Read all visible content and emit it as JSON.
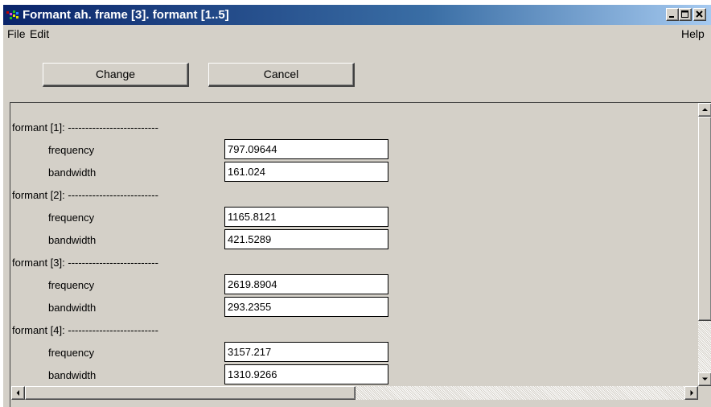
{
  "window": {
    "title": "Formant ah. frame [3]. formant [1..5]",
    "buttons": [
      "minimize-icon",
      "maximize-icon",
      "close-icon"
    ]
  },
  "menu": {
    "file": "File",
    "edit": "Edit",
    "help": "Help"
  },
  "toolbar": {
    "change_label": "Change",
    "cancel_label": "Cancel"
  },
  "formants": [
    {
      "header": "formant [1]: --------------------------",
      "frequency_label": "frequency",
      "frequency": "797.09644",
      "bandwidth_label": "bandwidth",
      "bandwidth": "161.024"
    },
    {
      "header": "formant [2]: --------------------------",
      "frequency_label": "frequency",
      "frequency": "1165.8121",
      "bandwidth_label": "bandwidth",
      "bandwidth": "421.5289"
    },
    {
      "header": "formant [3]: --------------------------",
      "frequency_label": "frequency",
      "frequency": "2619.8904",
      "bandwidth_label": "bandwidth",
      "bandwidth": "293.2355"
    },
    {
      "header": "formant [4]: --------------------------",
      "frequency_label": "frequency",
      "frequency": "3157.217",
      "bandwidth_label": "bandwidth",
      "bandwidth": "1310.9266"
    }
  ],
  "colors": {
    "titlebar_start": "#0a246a",
    "titlebar_end": "#a6caf0",
    "face": "#d4d0c8",
    "field_bg": "#ffffff"
  },
  "icons": [
    "app-icon",
    "scroll-up-icon",
    "scroll-down-icon",
    "scroll-left-icon",
    "scroll-right-icon"
  ]
}
